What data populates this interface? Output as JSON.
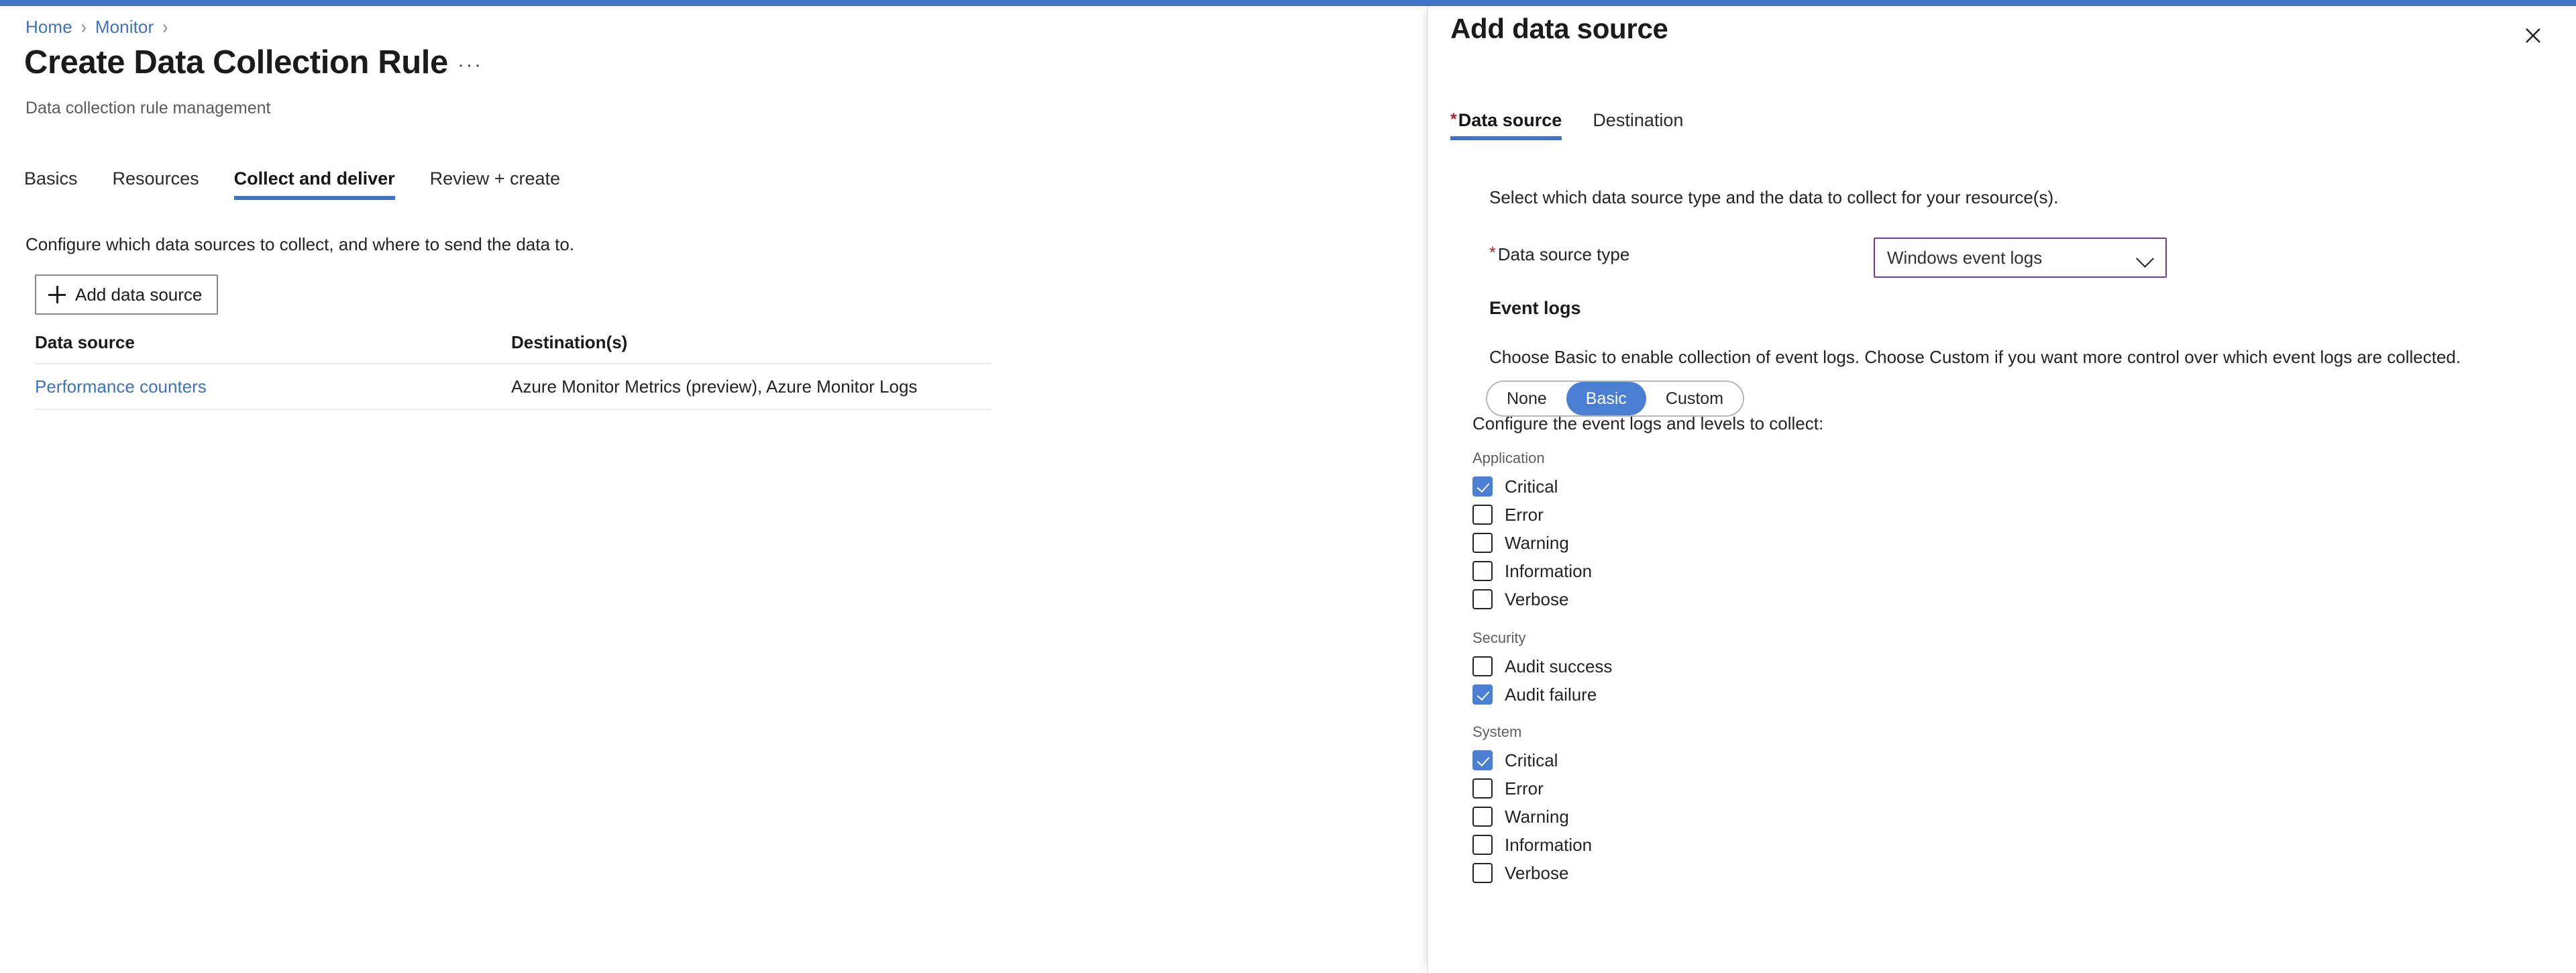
{
  "theme": {
    "accent": "#3e72c4",
    "link": "#3f72b8",
    "checkbox_checked": "#4a7fd4",
    "dropdown_border": "#783a8f",
    "required_star": "#a4262c"
  },
  "breadcrumb": {
    "items": [
      {
        "label": "Home"
      },
      {
        "label": "Monitor"
      }
    ],
    "separator": "›"
  },
  "header": {
    "title": "Create Data Collection Rule",
    "ellipsis": "···",
    "subtitle": "Data collection rule management"
  },
  "tabs": [
    {
      "label": "Basics",
      "active": false
    },
    {
      "label": "Resources",
      "active": false
    },
    {
      "label": "Collect and deliver",
      "active": true
    },
    {
      "label": "Review + create",
      "active": false
    }
  ],
  "main": {
    "description": "Configure which data sources to collect, and where to send the data to.",
    "add_button": {
      "label": "Add data source",
      "icon": "plus-icon"
    },
    "table": {
      "columns": [
        "Data source",
        "Destination(s)"
      ],
      "rows": [
        {
          "data_source": "Performance counters",
          "destinations": "Azure Monitor Metrics (preview), Azure Monitor Logs"
        }
      ]
    }
  },
  "panel": {
    "title": "Add data source",
    "close_label": "close-icon",
    "tabs": [
      {
        "label": "Data source",
        "required": true,
        "active": true
      },
      {
        "label": "Destination",
        "required": false,
        "active": false
      }
    ],
    "lead_text": "Select which data source type and the data to collect for your resource(s).",
    "data_source_type": {
      "label": "Data source type",
      "required": true,
      "value": "Windows event logs"
    },
    "event_logs": {
      "heading": "Event logs",
      "description": "Choose Basic to enable collection of event logs. Choose Custom if you want more control over which event logs are collected.",
      "segmented": {
        "options": [
          "None",
          "Basic",
          "Custom"
        ],
        "selected": "Basic"
      },
      "configure_text": "Configure the event logs and levels to collect:",
      "groups": [
        {
          "name": "Application",
          "items": [
            {
              "label": "Critical",
              "checked": true
            },
            {
              "label": "Error",
              "checked": false
            },
            {
              "label": "Warning",
              "checked": false
            },
            {
              "label": "Information",
              "checked": false
            },
            {
              "label": "Verbose",
              "checked": false
            }
          ]
        },
        {
          "name": "Security",
          "items": [
            {
              "label": "Audit success",
              "checked": false
            },
            {
              "label": "Audit failure",
              "checked": true
            }
          ]
        },
        {
          "name": "System",
          "items": [
            {
              "label": "Critical",
              "checked": true
            },
            {
              "label": "Error",
              "checked": false
            },
            {
              "label": "Warning",
              "checked": false
            },
            {
              "label": "Information",
              "checked": false
            },
            {
              "label": "Verbose",
              "checked": false
            }
          ]
        }
      ]
    }
  }
}
